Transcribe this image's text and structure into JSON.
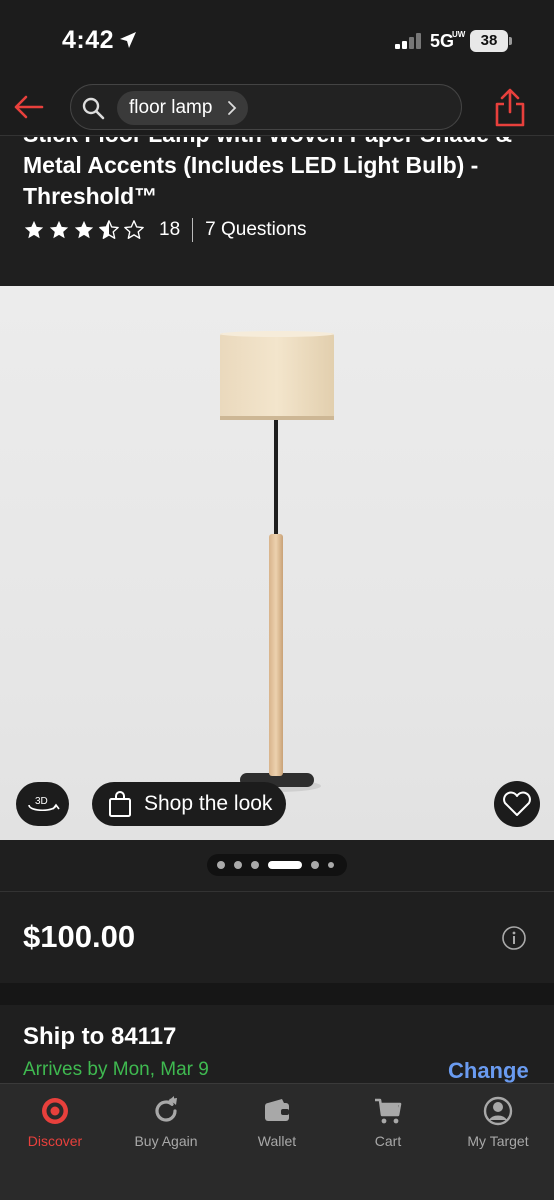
{
  "status_bar": {
    "time": "4:42",
    "network": "5G",
    "network_sub": "UW",
    "battery": "38"
  },
  "nav": {
    "search_query": "floor lamp"
  },
  "product": {
    "title": "Stick Floor Lamp with Woven Paper Shade & Metal Accents (Includes LED Light Bulb) - Threshold™",
    "rating": 3.5,
    "rating_max": 5,
    "review_count": "18",
    "questions_label": "7 Questions"
  },
  "image": {
    "shop_look_label": "Shop the look",
    "carousel_count": 6,
    "carousel_active_index": 3
  },
  "price": {
    "amount": "$100.00"
  },
  "shipping": {
    "title": "Ship to 84117",
    "arrives": "Arrives by Mon, Mar 9",
    "change_label": "Change"
  },
  "tabs": [
    {
      "label": "Discover",
      "icon": "target-bullseye-icon",
      "active": true
    },
    {
      "label": "Buy Again",
      "icon": "refresh-icon",
      "active": false
    },
    {
      "label": "Wallet",
      "icon": "wallet-icon",
      "active": false
    },
    {
      "label": "Cart",
      "icon": "cart-icon",
      "active": false
    },
    {
      "label": "My Target",
      "icon": "user-circle-icon",
      "active": false
    }
  ],
  "colors": {
    "brand_red": "#e8403c",
    "success_green": "#3fb950",
    "link_blue": "#6a9bf0",
    "background": "#1f1f1f"
  }
}
